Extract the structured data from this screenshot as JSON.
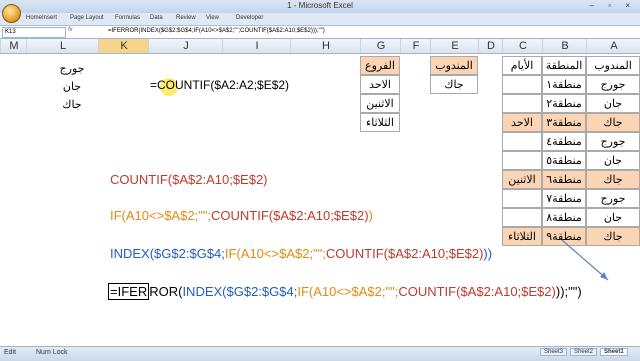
{
  "window": {
    "title": "1 - Microsoft Excel",
    "controls": "– ▫ ×"
  },
  "ribbon": {
    "tabs": [
      "Home",
      "Insert",
      "Page Layout",
      "Formulas",
      "Data",
      "Review",
      "View",
      "Developer"
    ]
  },
  "formula_bar": {
    "name_box": "K13",
    "fx": "fx",
    "content": "=IFERROR(INDEX($G$2:$G$4;IF(A10<>$A$2;\"\";COUNTIF($A$2:A10;$E$2)));\"\")"
  },
  "columns": [
    "M",
    "L",
    "K",
    "J",
    "I",
    "H",
    "G",
    "F",
    "E",
    "D",
    "C",
    "B",
    "A"
  ],
  "col_l_values": [
    "جورج",
    "جان",
    "جاك"
  ],
  "cell_formula_k": "=COUNTIF($A2:A2;$E$2)",
  "table_g": {
    "header": "الفروع",
    "rows": [
      "الاحد",
      "الاثنين",
      "الثلاثاء"
    ]
  },
  "table_e": {
    "header": "المندوب",
    "rows": [
      "جاك"
    ]
  },
  "table_abc": {
    "headers": [
      "الأيام",
      "المنطقة",
      "المندوب"
    ],
    "rows": [
      {
        "c": "",
        "b": "منطقة١",
        "a": "جورج",
        "hl": false
      },
      {
        "c": "",
        "b": "منطقة٢",
        "a": "جان",
        "hl": false
      },
      {
        "c": "الاحد",
        "b": "منطقة٣",
        "a": "جاك",
        "hl": true
      },
      {
        "c": "",
        "b": "منطقة٤",
        "a": "جورج",
        "hl": false
      },
      {
        "c": "",
        "b": "منطقة٥",
        "a": "جان",
        "hl": false
      },
      {
        "c": "الاثنين",
        "b": "منطقة٦",
        "a": "جاك",
        "hl": true
      },
      {
        "c": "",
        "b": "منطقة٧",
        "a": "جورج",
        "hl": false
      },
      {
        "c": "",
        "b": "منطقة٨",
        "a": "جان",
        "hl": false
      },
      {
        "c": "الثلاثاء",
        "b": "منطقة٩",
        "a": "جاك",
        "hl": true
      }
    ]
  },
  "formula_lines": {
    "line1": "COUNTIF($A$2:A10;$E$2)",
    "line2_a": "IF(A10<>$A$2;\"\";",
    "line2_b": "COUNTIF($A$2:A10;$E$2)",
    "line2_c": ")",
    "line3_a": "INDEX($G$2:$G$4;",
    "line3_b": "IF(A10<>$A$2;\"\";",
    "line3_c": "COUNTIF($A$2:A10;$E$2)",
    "line3_d": "))",
    "line4_a": "=IFER",
    "line4_b": "ROR(",
    "line4_c": "INDEX($G$2:$G$4;",
    "line4_d": "IF(A10<>$A$2;\"\";",
    "line4_e": "COUNTIF($A$2:A10;$E$2)",
    "line4_f": "));\"\")"
  },
  "status": {
    "mode": "Edit",
    "numlock": "Num Lock",
    "sheets": [
      "Sheet3",
      "Sheet2",
      "Sheet1"
    ]
  }
}
